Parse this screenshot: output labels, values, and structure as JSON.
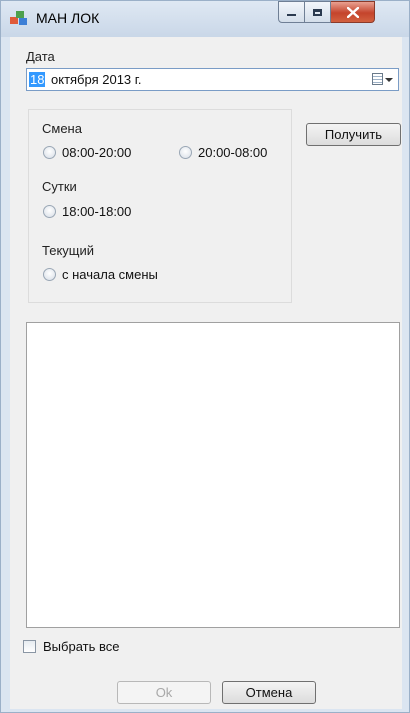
{
  "window": {
    "title": "МАН ЛОК"
  },
  "form": {
    "date_label": "Дата",
    "date_day": "18",
    "date_rest": "октября  2013 г.",
    "get_button": "Получить",
    "group": {
      "shift_label": "Смена",
      "shift_option1": "08:00-20:00",
      "shift_option2": "20:00-08:00",
      "day_label": "Сутки",
      "day_option": "18:00-18:00",
      "current_label": "Текущий",
      "current_option": "с начала смены"
    },
    "select_all_label": "Выбрать все",
    "ok_button": "Ok",
    "cancel_button": "Отмена"
  },
  "colors": {
    "selection": "#3399ff",
    "client_background": "#f0f0f0",
    "frame": "#dbe5f1"
  }
}
